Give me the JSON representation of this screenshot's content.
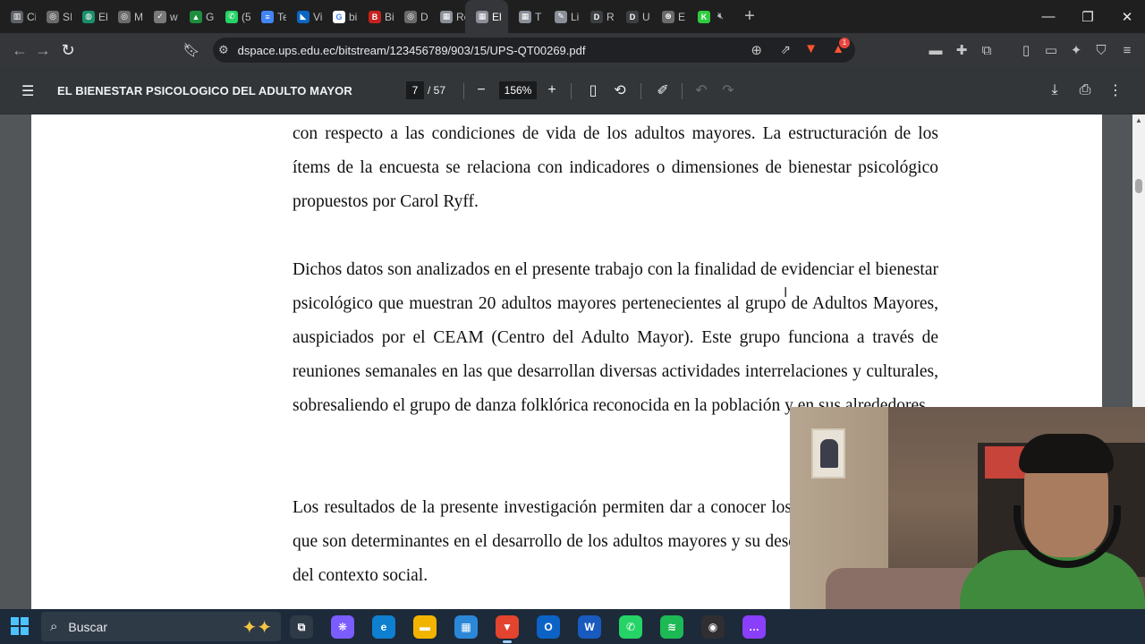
{
  "tabs": [
    {
      "label": "Ci",
      "color": "#5f6368",
      "glyph": "▥"
    },
    {
      "label": "SI",
      "color": "#6b6b6b",
      "glyph": "◎"
    },
    {
      "label": "El",
      "color": "#1a8f6a",
      "glyph": "◍"
    },
    {
      "label": "M",
      "color": "#6b6b6b",
      "glyph": "◎"
    },
    {
      "label": "w",
      "color": "#7a7a7a",
      "glyph": "✓"
    },
    {
      "label": "G",
      "color": "#1e8e3e",
      "glyph": "▲"
    },
    {
      "label": "(5",
      "color": "#25d366",
      "glyph": "✆"
    },
    {
      "label": "Te",
      "color": "#4285f4",
      "glyph": "≡"
    },
    {
      "label": "Vi",
      "color": "#0a66c2",
      "glyph": "◣"
    },
    {
      "label": "bi",
      "color": "#ffffff",
      "glyph": "G"
    },
    {
      "label": "Bi",
      "color": "#c5221f",
      "glyph": "B"
    },
    {
      "label": "D",
      "color": "#6b6b6b",
      "glyph": "◎"
    },
    {
      "label": "Re",
      "color": "#8a8f98",
      "glyph": "▦"
    },
    {
      "label": "El",
      "color": "#8a8f98",
      "glyph": "▦"
    },
    {
      "label": "T",
      "color": "#8a8f98",
      "glyph": "▦"
    },
    {
      "label": "Li",
      "color": "#8a8f98",
      "glyph": "✎"
    },
    {
      "label": "R",
      "color": "#3c4043",
      "glyph": "D"
    },
    {
      "label": "U",
      "color": "#3c4043",
      "glyph": "D"
    },
    {
      "label": "E",
      "color": "#6b6b6b",
      "glyph": "⊛"
    },
    {
      "label": "",
      "color": "#2ecc40",
      "glyph": "K"
    }
  ],
  "new_tab_label": "+",
  "window": {
    "minimize": "—",
    "maximize": "❐",
    "close": "✕"
  },
  "address": {
    "url": "dspace.ups.edu.ec/bitstream/123456789/903/15/UPS-QT00269.pdf"
  },
  "brave_badge": "1",
  "pdf": {
    "title": "EL BIENESTAR PSICOLOGICO DEL ADULTO MAYOR",
    "page_current": "7",
    "page_total": "/ 57",
    "zoom": "156%"
  },
  "paragraphs": {
    "p1": "con respecto a las condiciones de vida de los adultos mayores. La estructuración de los ítems de la encuesta se relaciona con indicadores o dimensiones de bienestar psicológico propuestos por Carol Ryff.",
    "p2": "Dichos datos son analizados en el presente trabajo  con la finalidad de  evidenciar el bienestar psicológico que muestran 20 adultos mayores pertenecientes al grupo de Adultos Mayores, auspiciados por el CEAM (Centro del Adulto Mayor). Este grupo funciona a través de reuniones semanales en las que desarrollan diversas actividades interrelaciones y culturales, sobresaliendo el grupo de danza folklórica reconocida en la población y en sus alrededores.",
    "p3": "Los resultados de la presente investigación permiten dar a conocer los aspectos de la vejez  que son determinantes en el desarrollo de los adultos mayores y su desenvolvimiento dentro del contexto social."
  },
  "taskbar": {
    "search_placeholder": "Buscar",
    "apps": [
      {
        "name": "task-view",
        "color": "#2f3a47",
        "glyph": "⧉"
      },
      {
        "name": "copilot",
        "color": "#7b5cff",
        "glyph": "❋"
      },
      {
        "name": "edge",
        "color": "#0f7fd0",
        "glyph": "e"
      },
      {
        "name": "file-explorer",
        "color": "#f2b400",
        "glyph": "▬"
      },
      {
        "name": "microsoft-store",
        "color": "#2b88d8",
        "glyph": "▦"
      },
      {
        "name": "brave",
        "color": "#e2442f",
        "glyph": "▼"
      },
      {
        "name": "outlook",
        "color": "#0b63c6",
        "glyph": "O"
      },
      {
        "name": "word",
        "color": "#185abd",
        "glyph": "W"
      },
      {
        "name": "whatsapp",
        "color": "#25d366",
        "glyph": "✆"
      },
      {
        "name": "spotify",
        "color": "#1db954",
        "glyph": "≋"
      },
      {
        "name": "obs",
        "color": "#302e31",
        "glyph": "◉"
      },
      {
        "name": "messenger",
        "color": "#8a3ffc",
        "glyph": "…"
      }
    ]
  }
}
